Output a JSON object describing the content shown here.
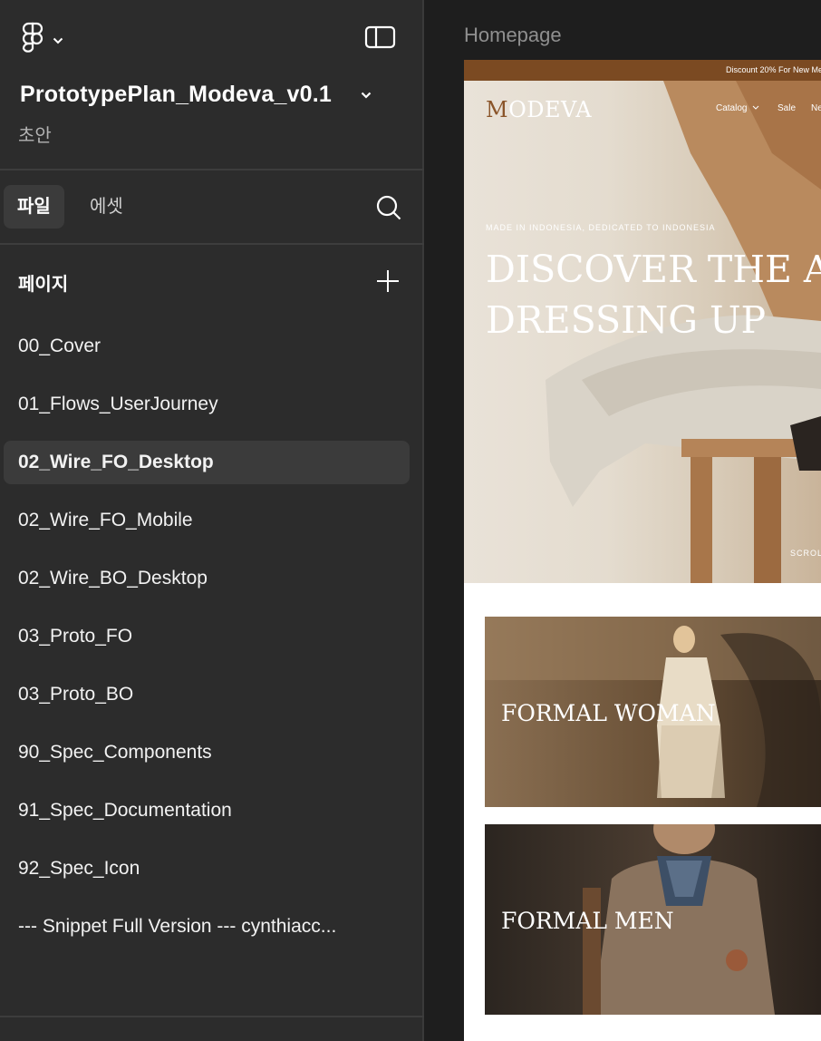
{
  "sidebar": {
    "file_title": "PrototypePlan_Modeva_v0.1",
    "file_status": "초안",
    "tabs": [
      {
        "label": "파일",
        "active": true
      },
      {
        "label": "에셋",
        "active": false
      }
    ],
    "pages_heading": "페이지",
    "pages": [
      {
        "label": "00_Cover"
      },
      {
        "label": "01_Flows_UserJourney"
      },
      {
        "label": "02_Wire_FO_Desktop",
        "selected": true
      },
      {
        "label": "02_Wire_FO_Mobile"
      },
      {
        "label": "02_Wire_BO_Desktop"
      },
      {
        "label": "03_Proto_FO"
      },
      {
        "label": "03_Proto_BO"
      },
      {
        "label": "90_Spec_Components"
      },
      {
        "label": "91_Spec_Documentation"
      },
      {
        "label": "92_Spec_Icon"
      },
      {
        "label": "--- Snippet Full Version --- cynthiacc..."
      }
    ],
    "icons": [
      "figma-logo-icon",
      "chevron-down-icon",
      "sidebar-toggle-icon",
      "search-icon",
      "plus-icon"
    ]
  },
  "canvas": {
    "frame_label": "Homepage",
    "website": {
      "promo_text": "Discount 20% For New Me",
      "brand_first": "M",
      "brand_rest": "ODEVA",
      "nav": [
        "Catalog",
        "Sale",
        "Ne"
      ],
      "eyebrow": "MADE IN INDONESIA, DEDICATED TO INDONESIA",
      "headline_line1": "DISCOVER THE AR",
      "headline_line2": "DRESSING UP",
      "scroll_label": "SCROL",
      "categories": [
        {
          "label": "FORMAL WOMAN"
        },
        {
          "label": "FORMAL MEN"
        }
      ]
    }
  },
  "colors": {
    "sidebar_bg": "#2c2c2c",
    "canvas_bg": "#1e1e1e",
    "selected_bg": "#3b3b3b",
    "promo_bar": "#7b4a22",
    "brand_accent": "#8a5429"
  }
}
